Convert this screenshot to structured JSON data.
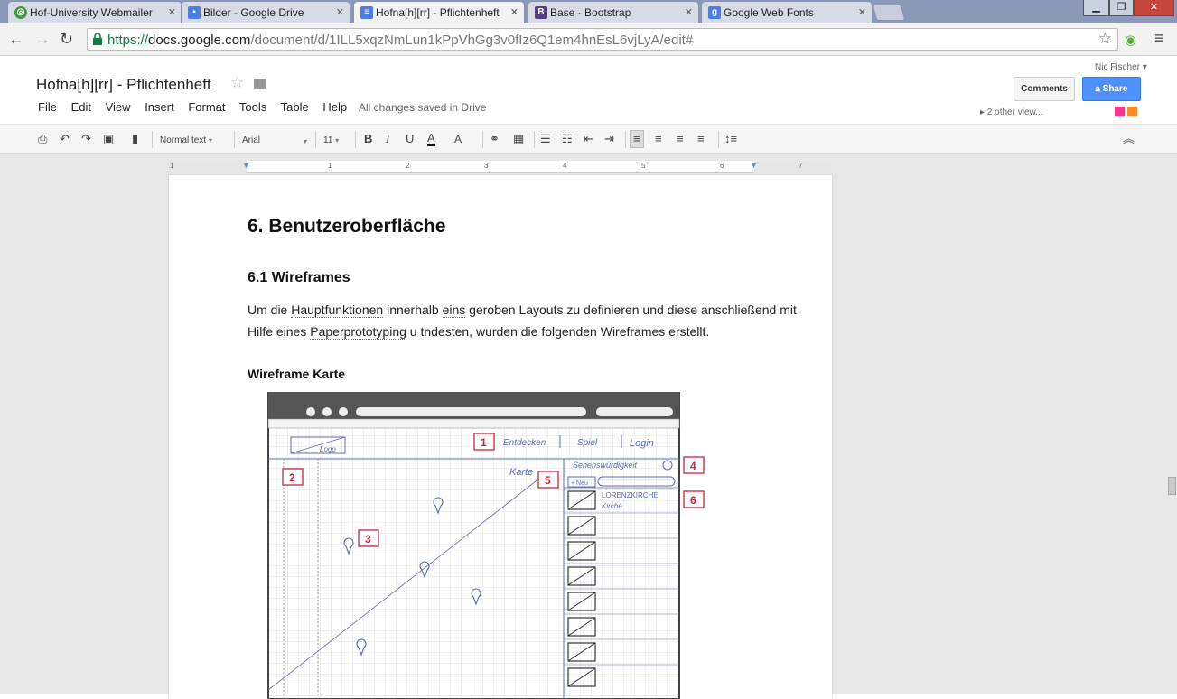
{
  "browser": {
    "tabs": [
      {
        "title": "Hof-University Webmailer",
        "favicon": "webmail-icon"
      },
      {
        "title": "Bilder - Google Drive",
        "favicon": "google-drive-icon"
      },
      {
        "title": "Hofna[h][rr] - Pflichtenheft",
        "favicon": "google-docs-icon",
        "active": true
      },
      {
        "title": "Base · Bootstrap",
        "favicon": "bootstrap-icon"
      },
      {
        "title": "Google Web Fonts",
        "favicon": "google-icon"
      }
    ],
    "url_scheme": "https://",
    "url_host": "docs.google.com",
    "url_path": "/document/d/1ILL5xqzNmLun1kPpVhGg3v0fIz6Q1em4hnEsL6vjLyA/edit#"
  },
  "doc": {
    "title": "Hofna[h][rr] - Pflichtenheft",
    "menu": [
      "File",
      "Edit",
      "View",
      "Insert",
      "Format",
      "Tools",
      "Table",
      "Help"
    ],
    "save_status": "All changes saved in Drive",
    "user": "Nic Fischer",
    "comments_label": "Comments",
    "share_label": "Share",
    "viewers": "2 other view...",
    "viewer_colors": [
      "#f4388a",
      "#f68c2d"
    ]
  },
  "toolbar": {
    "style": "Normal text",
    "font": "Arial",
    "size": "11"
  },
  "ruler": [
    "1",
    "1",
    "2",
    "3",
    "4",
    "5",
    "6",
    "7"
  ],
  "content": {
    "heading": "6. Benutzeroberfläche",
    "subheading": "6.1 Wireframes",
    "para_1": "Um die ",
    "para_sp1": "Hauptfunktionen",
    "para_2": " innerhalb ",
    "para_sp2": "eins",
    "para_3": " geroben Layouts zu definieren und diese anschließend mit Hilfe eines ",
    "para_sp3": "Paperprototyping",
    "para_4": " u tndesten, wurden die folgenden Wireframes erstellt.",
    "figure_title": "Wireframe Karte",
    "sketch": {
      "nav_items": [
        "Entdecken",
        "Spiel",
        "Login"
      ],
      "logo": "Logo",
      "map_label": "Karte",
      "dropdown": "Sehenswürdigkeit",
      "new_button": "+ Neu",
      "list_first_title": "LORENZKIRCHE",
      "list_first_sub": "Kirche",
      "callouts": [
        "1",
        "2",
        "3",
        "4",
        "5",
        "6"
      ]
    }
  }
}
